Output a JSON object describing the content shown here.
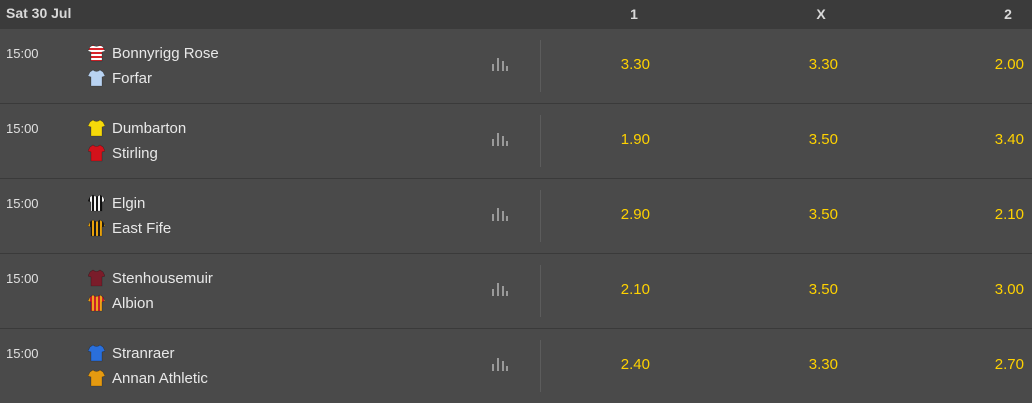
{
  "header": {
    "date": "Sat 30 Jul",
    "col_home": "1",
    "col_draw": "X",
    "col_away": "2"
  },
  "colors": {
    "odds": "#ffd200",
    "background": "#4a4a4a",
    "header_bg": "#3b3b3b"
  },
  "matches": [
    {
      "time": "15:00",
      "home": "Bonnyrigg Rose",
      "away": "Forfar",
      "home_kit": "red-white-hoops-shirt-icon",
      "away_kit": "light-blue-shirt-icon",
      "odds": {
        "home": "3.30",
        "draw": "3.30",
        "away": "2.00"
      }
    },
    {
      "time": "15:00",
      "home": "Dumbarton",
      "away": "Stirling",
      "home_kit": "yellow-shirt-icon",
      "away_kit": "red-shirt-icon",
      "odds": {
        "home": "1.90",
        "draw": "3.50",
        "away": "3.40"
      }
    },
    {
      "time": "15:00",
      "home": "Elgin",
      "away": "East Fife",
      "home_kit": "black-white-stripes-shirt-icon",
      "away_kit": "amber-black-stripes-shirt-icon",
      "odds": {
        "home": "2.90",
        "draw": "3.50",
        "away": "2.10"
      }
    },
    {
      "time": "15:00",
      "home": "Stenhousemuir",
      "away": "Albion",
      "home_kit": "maroon-shirt-icon",
      "away_kit": "amber-red-stripes-shirt-icon",
      "odds": {
        "home": "2.10",
        "draw": "3.50",
        "away": "3.00"
      }
    },
    {
      "time": "15:00",
      "home": "Stranraer",
      "away": "Annan Athletic",
      "home_kit": "blue-shirt-icon",
      "away_kit": "gold-black-shirt-icon",
      "odds": {
        "home": "2.40",
        "draw": "3.30",
        "away": "2.70"
      }
    }
  ]
}
